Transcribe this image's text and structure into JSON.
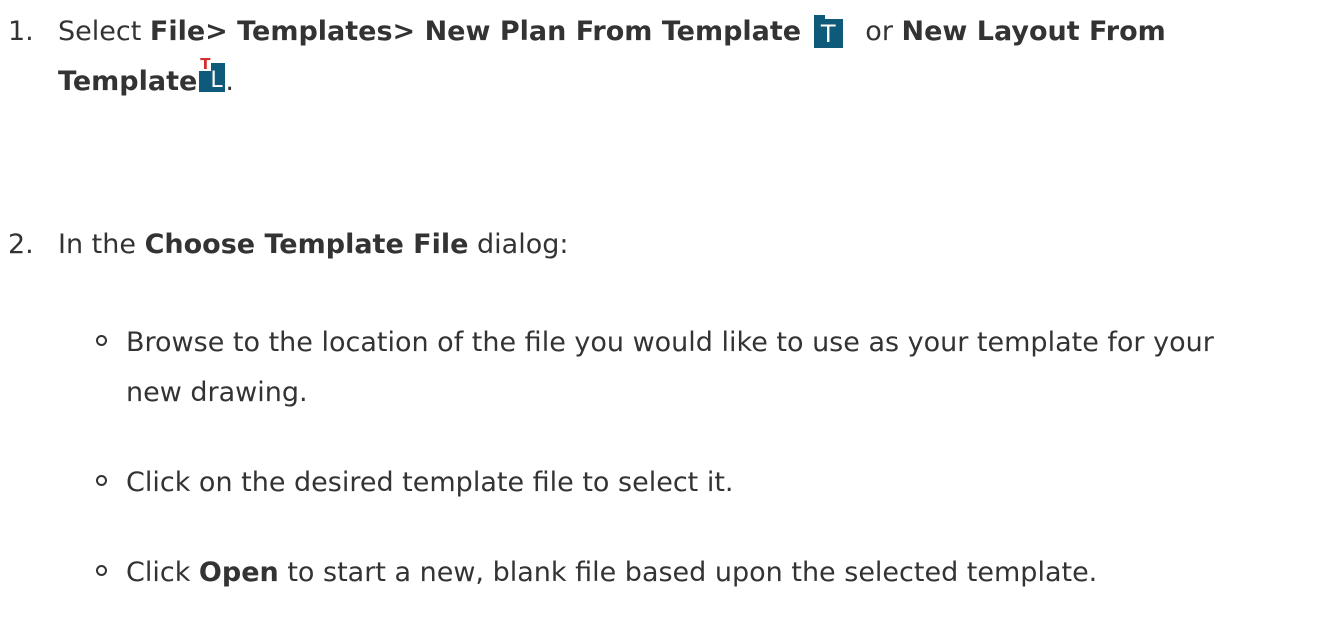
{
  "steps": [
    {
      "number": "1.",
      "prefix": "Select ",
      "menu_path": "File> Templates> New Plan From Template",
      "connector": " or ",
      "layout_option_line1": "New Layout From",
      "layout_option_line2": "Template",
      "suffix": ".",
      "icons": [
        "template-plan-icon",
        "template-layout-icon"
      ]
    },
    {
      "number": "2.",
      "prefix": "In the ",
      "dialog_name": "Choose Template File",
      "suffix": " dialog:"
    }
  ],
  "substeps": [
    {
      "text_line1": "Browse to the location of the file you would like to use as your template for your",
      "text_line2": "new drawing."
    },
    {
      "text": "Click on the desired template file to select it."
    },
    {
      "prefix": "Click ",
      "button_name": "Open",
      "suffix": " to start a new, blank file based upon the selected template."
    }
  ],
  "icon_glyphs": {
    "plan_template": "T",
    "layout_template_t": "T",
    "layout_template_l": "L"
  },
  "colors": {
    "text": "#333333",
    "icon_bg": "#0e5a7a",
    "icon_accent_red": "#d32f2f"
  }
}
